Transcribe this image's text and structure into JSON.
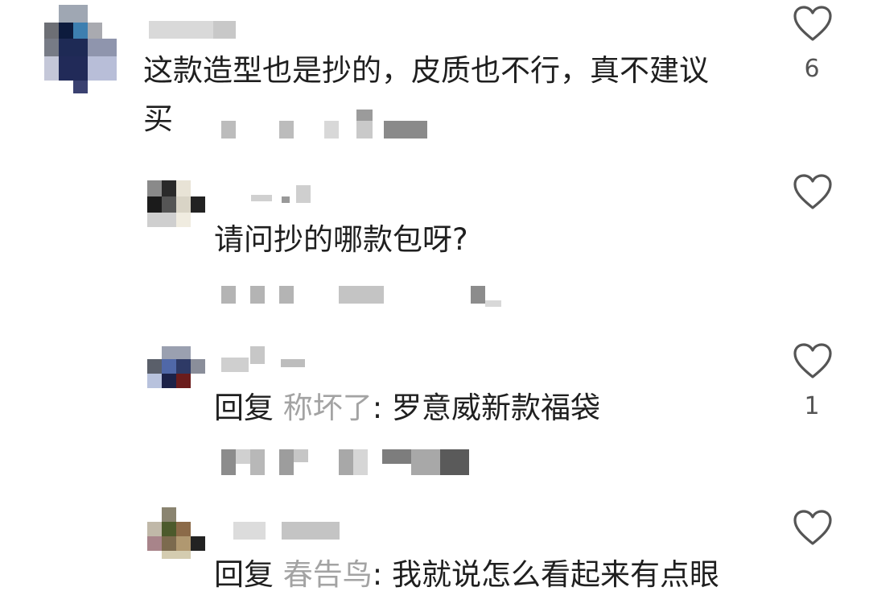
{
  "comments": [
    {
      "text_line1": "这款造型也是抄的，皮质也不行，真不建议",
      "text_line2": "买",
      "likes": "6"
    },
    {
      "text": "请问抄的哪款包呀?",
      "likes": ""
    },
    {
      "reply_prefix": "回复",
      "reply_target": "称坏了",
      "text": ": 罗意威新款福袋",
      "likes": "1"
    },
    {
      "reply_prefix": "回复",
      "reply_target": "春告鸟",
      "text": ": 我就说怎么看起来有点眼",
      "likes": ""
    }
  ]
}
